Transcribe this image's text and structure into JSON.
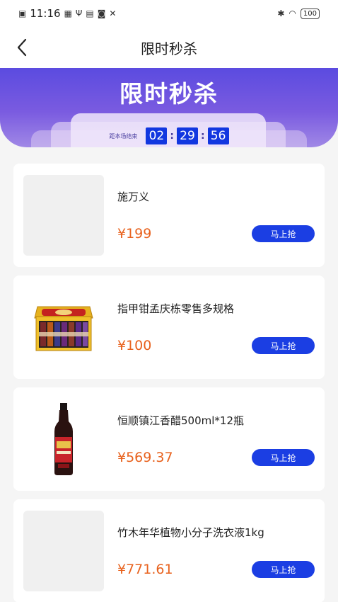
{
  "status_bar": {
    "time": "11:16",
    "battery": "100"
  },
  "nav": {
    "title": "限时秒杀"
  },
  "banner": {
    "title": "限时秒杀",
    "countdown_label": "距本场结束",
    "hours": "02",
    "minutes": "29",
    "seconds": "56",
    "separator": ":"
  },
  "products": [
    {
      "name": "施万义",
      "price": "¥199",
      "button": "马上抢",
      "image": "placeholder"
    },
    {
      "name": "指甲钳孟庆栋零售多规格",
      "price": "¥100",
      "button": "马上抢",
      "image": "gift-box-photo"
    },
    {
      "name": "恒顺镇江香醋500ml*12瓶",
      "price": "¥569.37",
      "button": "马上抢",
      "image": "vinegar-bottle-photo"
    },
    {
      "name": "竹木年华植物小分子洗衣液1kg",
      "price": "¥771.61",
      "button": "马上抢",
      "image": "placeholder"
    }
  ],
  "colors": {
    "accent": "#1b3ee3",
    "price": "#e8621e",
    "banner_top": "#5b4be0",
    "banner_bottom": "#a088e6"
  }
}
